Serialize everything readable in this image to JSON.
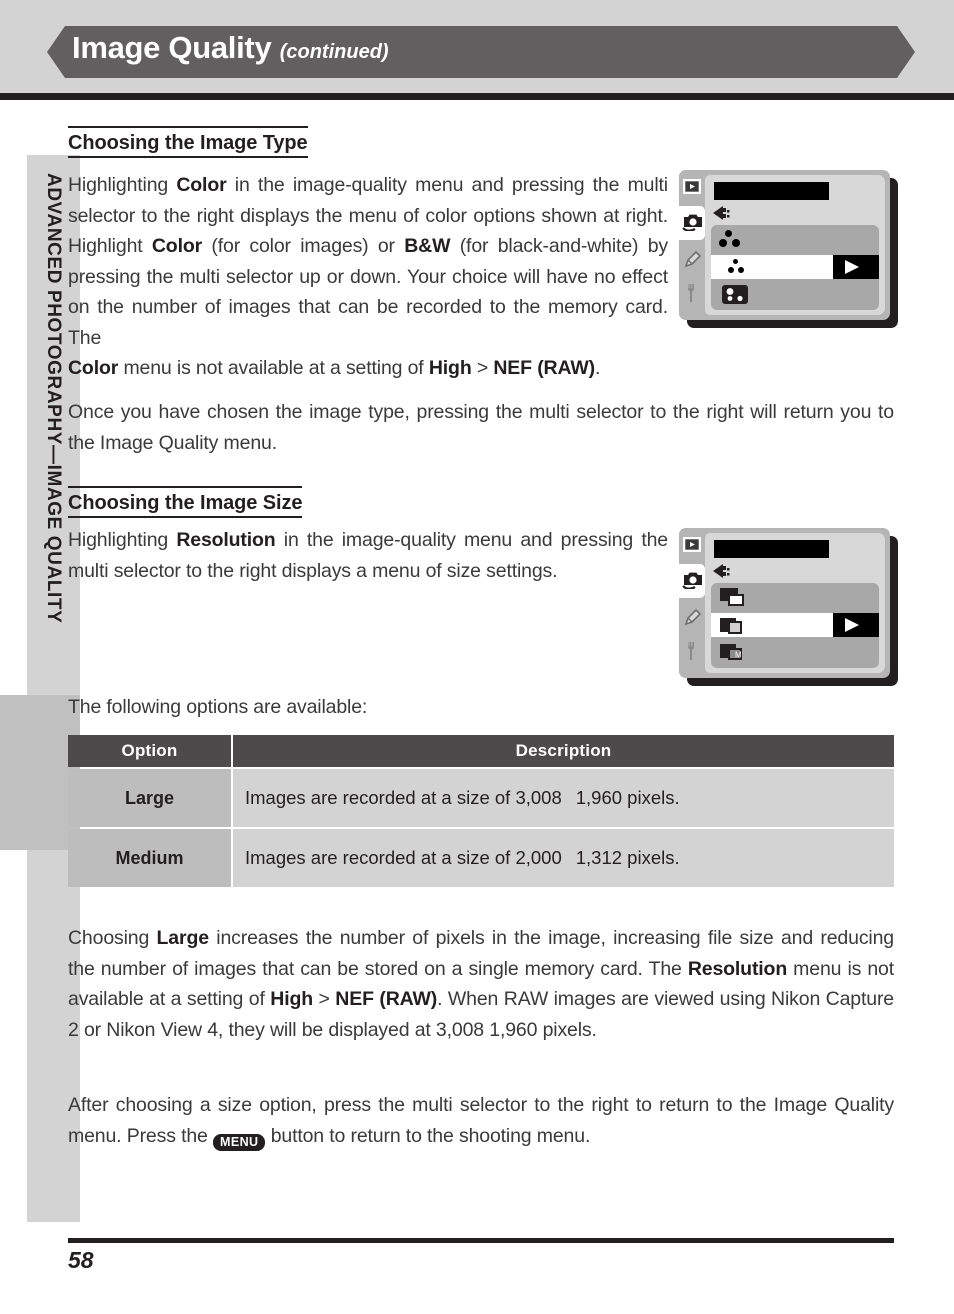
{
  "header": {
    "title": "Image Quality",
    "continued": "(continued)"
  },
  "sidebar": {
    "label": "ADVANCED PHOTOGRAPHY—IMAGE QUALITY"
  },
  "sections": [
    {
      "heading": "Choosing the Image Type",
      "paragraphs": [
        "Once you have chosen the image type, pressing the multi selector to the right will return you to the Image Quality menu."
      ]
    },
    {
      "heading": "Choosing the Image Size",
      "paragraphs": []
    }
  ],
  "body": {
    "p1_a": "Highlighting ",
    "p1_b1": "Color",
    "p1_c": " in the image-quality menu and pressing the multi selector to the right displays the menu of color options shown at right.  Highlight ",
    "p1_b2": "Color",
    "p1_d": " (for color images) or ",
    "p1_b3": "B&W",
    "p1_e": " (for black-and-white) by pressing the multi selector up or down. Your choice will have no effect on the number of images that can be recorded to the memory card. The ",
    "p1_b4": "Color",
    "p1_f": " menu is not available at a setting of ",
    "p1_b5": "High",
    "p1_g": " > ",
    "p1_b6": "NEF (RAW)",
    "p1_h": ".",
    "p2": "Once you have chosen the image type, pressing the multi selector to the right will return you to the Image Quality menu.",
    "p3_a": "Highlighting ",
    "p3_b1": "Resolution",
    "p3_c": " in the image-quality menu and pressing the multi selector to the right displays a menu of size settings.",
    "p4": "The following options are available:",
    "p5_a": "Choosing ",
    "p5_b1": "Large",
    "p5_c": " increases the number of pixels in the image, increasing file size and reducing the number of images that can be stored on a single memory card.  The ",
    "p5_b2": "Resolution",
    "p5_d": " menu is not available at a setting of ",
    "p5_b3": "High",
    "p5_e": " > ",
    "p5_b4": "NEF (RAW)",
    "p5_f": ".  When RAW images are viewed using Nikon Capture 2 or Nikon View 4, they will be displayed at 3,008 ",
    "p5_g": " 1,960 pixels.",
    "p6_a": "After choosing a size option, press the multi selector to the right to return to the Image Quality menu.  Press the ",
    "p6_badge": "MENU",
    "p6_b": " button to return to the shooting menu."
  },
  "table": {
    "columns": [
      "Option",
      "Description"
    ],
    "rows": [
      {
        "option": "Large",
        "desc_pre": "Images are recorded at a size of 3,008",
        "desc_post": "1,960 pixels."
      },
      {
        "option": "Medium",
        "desc_pre": "Images are recorded at a size of 2,000",
        "desc_post": "1,312 pixels."
      }
    ]
  },
  "lcd_color_menu": {
    "caption": "camera color menu illustration",
    "tabs": [
      "playback-icon",
      "shooting-icon",
      "custom-pencil-icon",
      "setup-wrench-icon"
    ],
    "selected_tab": "shooting-icon",
    "rows": [
      "color-3dot-icon",
      "color-3dot-small-icon",
      "bw-image-icon"
    ],
    "selected_row_index": 1
  },
  "lcd_size_menu": {
    "caption": "camera image size menu illustration",
    "tabs": [
      "playback-icon",
      "shooting-icon",
      "custom-pencil-icon",
      "setup-wrench-icon"
    ],
    "selected_tab": "shooting-icon",
    "rows": [
      "size-large-icon",
      "size-selected-icon",
      "size-medium-icon"
    ],
    "selected_row_index": 1
  },
  "footer": {
    "page": "58"
  },
  "colors": {
    "banner": "#615f60",
    "header_band": "#d3d3d3",
    "rule": "#231f20",
    "table_header": "#4d4a4b",
    "table_option_cell": "#bdbdbd",
    "table_desc_cell": "#d3d3d3",
    "lcd_bezel": "#b5b5b5",
    "lcd_screen": "#d8d8d8",
    "lcd_list": "#a8a8a8"
  }
}
